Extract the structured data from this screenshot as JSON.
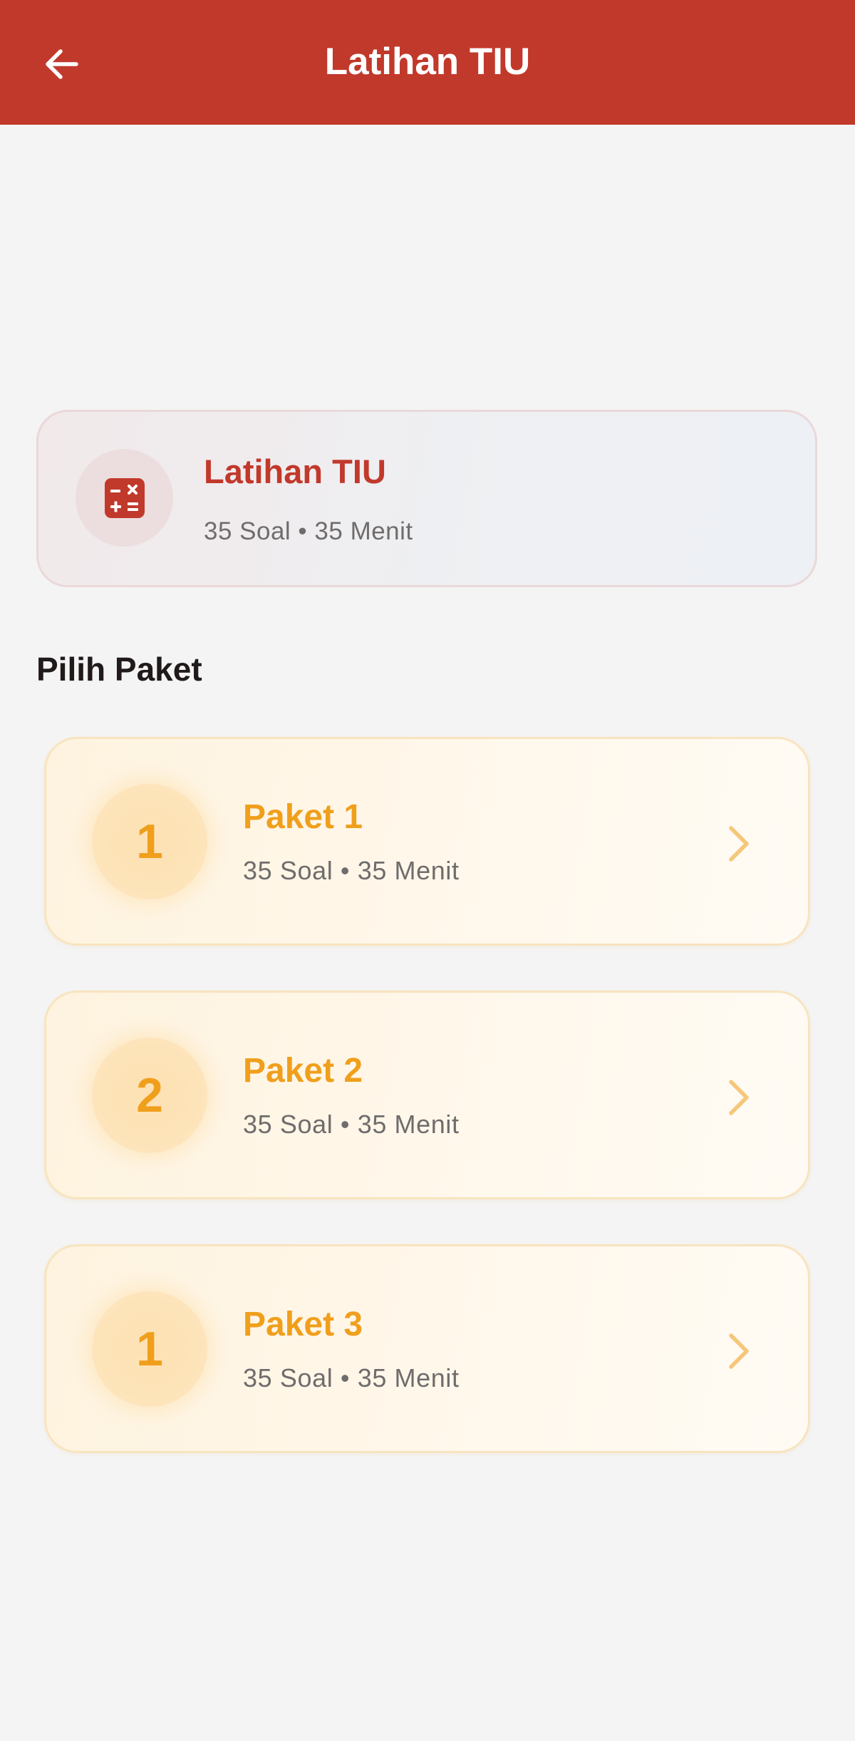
{
  "app_bar": {
    "title": "Latihan TIU",
    "back_icon": "arrow-left-icon",
    "background_color": "#c1392b"
  },
  "info_card": {
    "icon": "calculator-icon",
    "title": "Latihan TIU",
    "meta": "35 Soal • 35 Menit",
    "accent_color": "#c1392b"
  },
  "section": {
    "title": "Pilih Paket"
  },
  "packages": [
    {
      "number": "1",
      "title": "Paket 1",
      "meta": "35 Soal • 35 Menit"
    },
    {
      "number": "2",
      "title": "Paket 2",
      "meta": "35 Soal • 35 Menit"
    },
    {
      "number": "1",
      "title": "Paket 3",
      "meta": "35 Soal • 35 Menit"
    }
  ],
  "colors": {
    "package_accent": "#f09f1c",
    "page_background": "#f4f4f4"
  }
}
